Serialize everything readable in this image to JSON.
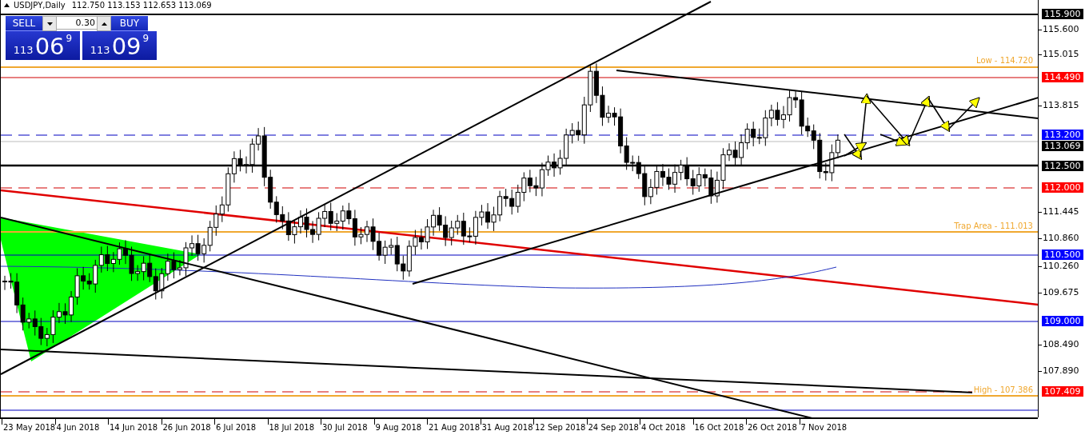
{
  "chart_header": {
    "symbol": "USDJPY,Daily",
    "ohlc": "112.750 113.153 112.653 113.069"
  },
  "trade_panel": {
    "sell_label": "SELL",
    "buy_label": "BUY",
    "lot": "0.30",
    "sell_quote": {
      "big_figure": "113",
      "pips": "06",
      "fraction": "9"
    },
    "buy_quote": {
      "big_figure": "113",
      "pips": "09",
      "fraction": "9"
    }
  },
  "level_labels": [
    {
      "text": "Low - 114.720",
      "kind": "low"
    },
    {
      "text": "Trap Area - 111.013",
      "kind": "trap"
    },
    {
      "text": "High - 107.386",
      "kind": "high"
    }
  ],
  "price_axis": [
    {
      "text": "115.900",
      "kind": "marker",
      "color": "#000000"
    },
    {
      "text": "115.600",
      "kind": "tick"
    },
    {
      "text": "115.015",
      "kind": "tick"
    },
    {
      "text": "114.490",
      "kind": "marker",
      "color": "#ff0000"
    },
    {
      "text": "113.815",
      "kind": "tick"
    },
    {
      "text": "113.200",
      "kind": "marker",
      "color": "#0000ff"
    },
    {
      "text": "113.069",
      "kind": "marker",
      "color": "#000000"
    },
    {
      "text": "112.500",
      "kind": "marker",
      "color": "#000000"
    },
    {
      "text": "112.000",
      "kind": "marker",
      "color": "#ff0000"
    },
    {
      "text": "111.445",
      "kind": "tick"
    },
    {
      "text": "110.860",
      "kind": "tick"
    },
    {
      "text": "110.500",
      "kind": "marker",
      "color": "#0000ff"
    },
    {
      "text": "110.260",
      "kind": "tick"
    },
    {
      "text": "109.675",
      "kind": "tick"
    },
    {
      "text": "109.000",
      "kind": "marker",
      "color": "#0000ff"
    },
    {
      "text": "108.490",
      "kind": "tick"
    },
    {
      "text": "107.890",
      "kind": "tick"
    },
    {
      "text": "107.409",
      "kind": "marker",
      "color": "#ff0000"
    }
  ],
  "time_axis": [
    "23 May 2018",
    "4 Jun 2018",
    "14 Jun 2018",
    "26 Jun 2018",
    "6 Jul 2018",
    "18 Jul 2018",
    "30 Jul 2018",
    "9 Aug 2018",
    "21 Aug 2018",
    "31 Aug 2018",
    "12 Sep 2018",
    "24 Sep 2018",
    "4 Oct 2018",
    "16 Oct 2018",
    "26 Oct 2018",
    "7 Nov 2018"
  ]
}
